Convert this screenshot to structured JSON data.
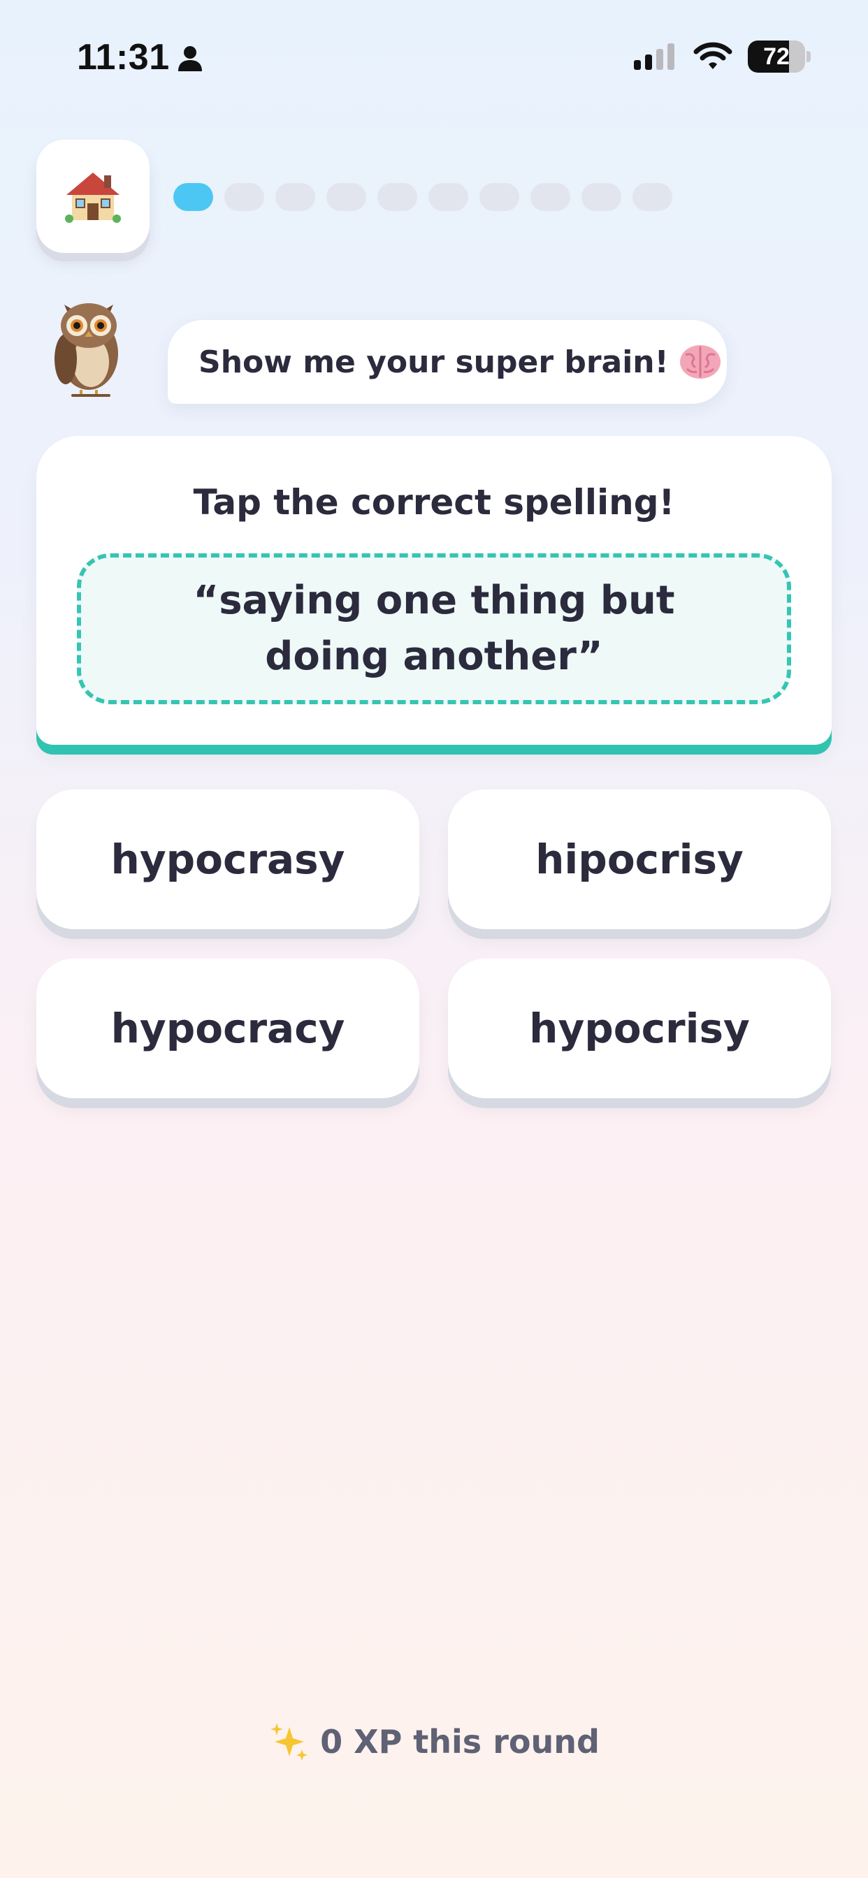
{
  "status_bar": {
    "time": "11:31",
    "battery_level": "72",
    "battery_fraction": 0.72
  },
  "progress": {
    "total_steps": 10,
    "current_step": 1
  },
  "icons": {
    "home": "house-icon",
    "mascot": "owl-icon",
    "brain": "brain-icon",
    "sparkles": "sparkles-icon"
  },
  "mascot": {
    "message": "Show me your super brain!"
  },
  "question": {
    "prompt": "Tap the correct spelling!",
    "definition": "“saying one thing but doing another”"
  },
  "answers": [
    {
      "label": "hypocrasy"
    },
    {
      "label": "hipocrisy"
    },
    {
      "label": "hypocracy"
    },
    {
      "label": "hypocrisy"
    }
  ],
  "footer": {
    "xp_text": "0 XP this round"
  },
  "colors": {
    "accent_teal": "#2fc3b0",
    "progress_active": "#4cc7f4",
    "progress_inactive": "#e2e5ee",
    "text_dark": "#2b2b3d"
  }
}
